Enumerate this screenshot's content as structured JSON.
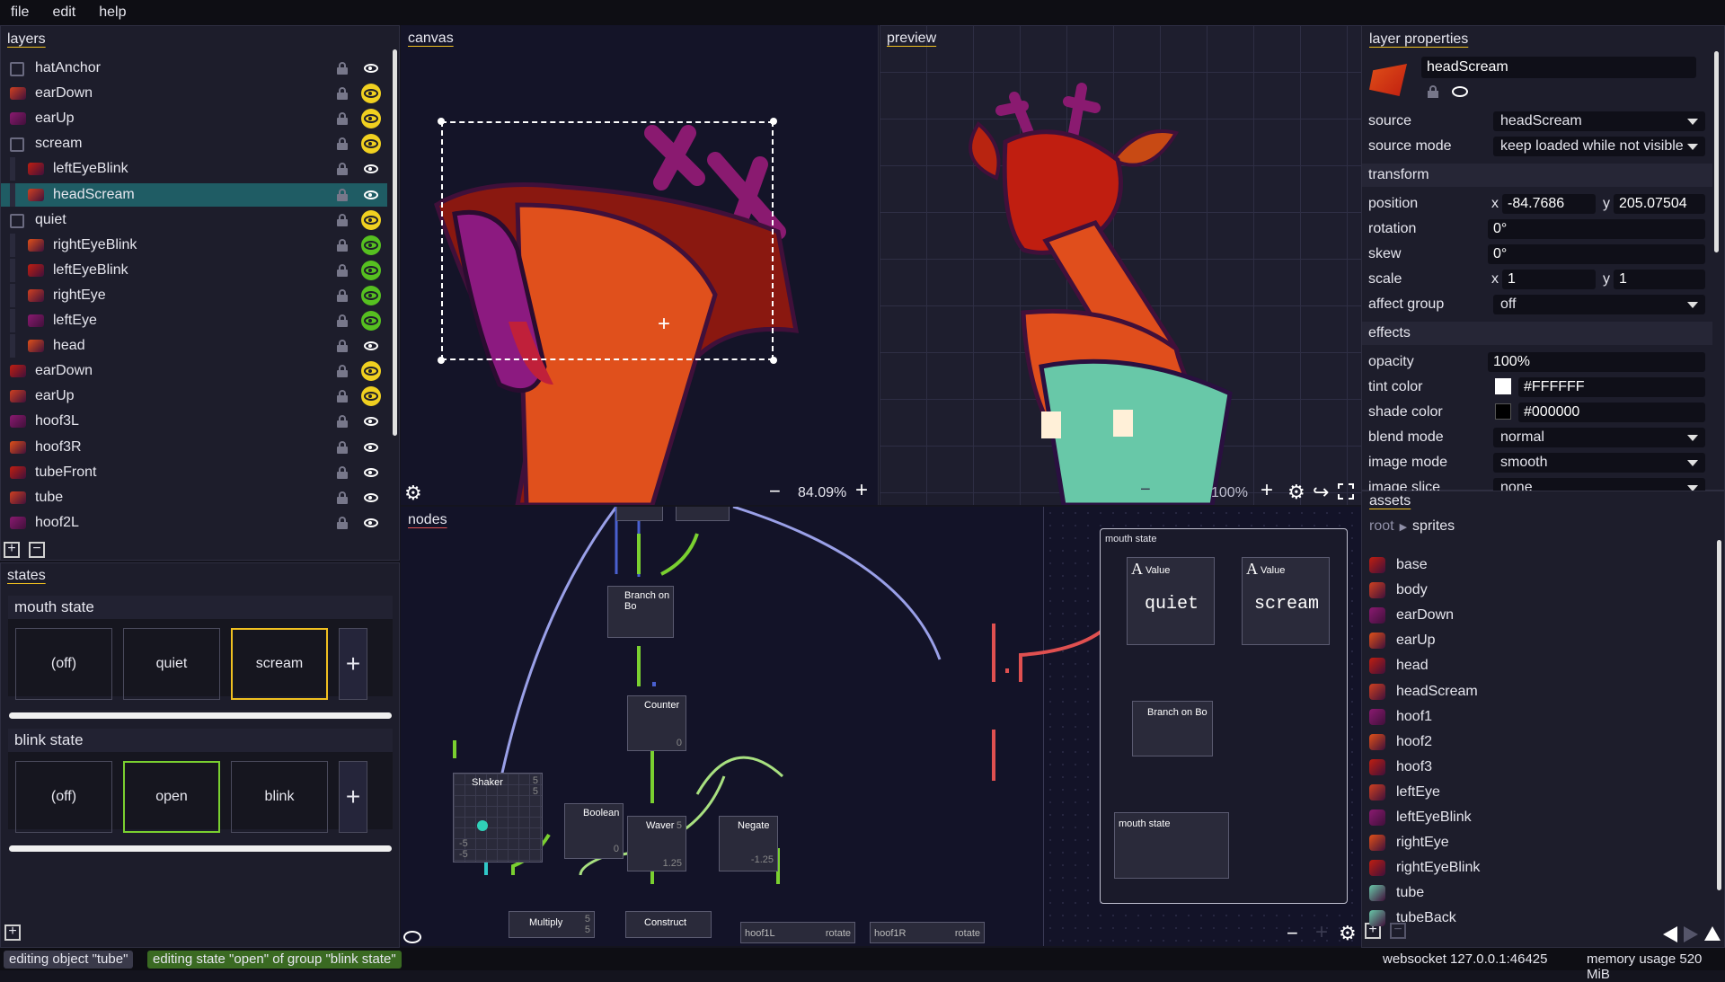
{
  "menu": {
    "file": "file",
    "edit": "edit",
    "help": "help"
  },
  "layers": {
    "title": "layers",
    "items": [
      {
        "name": "hatAnchor",
        "indent": 0,
        "icon": "checkbox",
        "eye": "plain"
      },
      {
        "name": "earDown",
        "indent": 0,
        "icon": "sprite",
        "eye": "yellow"
      },
      {
        "name": "earUp",
        "indent": 0,
        "icon": "sprite",
        "eye": "yellow"
      },
      {
        "name": "scream",
        "indent": 0,
        "icon": "checkbox",
        "eye": "yellow"
      },
      {
        "name": "leftEyeBlink",
        "indent": 1,
        "icon": "sprite",
        "eye": "plain"
      },
      {
        "name": "headScream",
        "indent": 1,
        "icon": "sprite",
        "eye": "plain",
        "selected": true
      },
      {
        "name": "quiet",
        "indent": 0,
        "icon": "checkbox",
        "eye": "yellow"
      },
      {
        "name": "rightEyeBlink",
        "indent": 1,
        "icon": "sprite",
        "eye": "green"
      },
      {
        "name": "leftEyeBlink",
        "indent": 1,
        "icon": "sprite",
        "eye": "green"
      },
      {
        "name": "rightEye",
        "indent": 1,
        "icon": "sprite",
        "eye": "green"
      },
      {
        "name": "leftEye",
        "indent": 1,
        "icon": "sprite",
        "eye": "green"
      },
      {
        "name": "head",
        "indent": 1,
        "icon": "sprite",
        "eye": "plain"
      },
      {
        "name": "earDown",
        "indent": 0,
        "icon": "sprite",
        "eye": "yellow"
      },
      {
        "name": "earUp",
        "indent": 0,
        "icon": "sprite",
        "eye": "yellow"
      },
      {
        "name": "hoof3L",
        "indent": 0,
        "icon": "sprite",
        "eye": "plain"
      },
      {
        "name": "hoof3R",
        "indent": 0,
        "icon": "sprite",
        "eye": "plain"
      },
      {
        "name": "tubeFront",
        "indent": 0,
        "icon": "sprite",
        "eye": "plain"
      },
      {
        "name": "tube",
        "indent": 0,
        "icon": "sprite",
        "eye": "plain"
      },
      {
        "name": "hoof2L",
        "indent": 0,
        "icon": "sprite",
        "eye": "plain"
      }
    ]
  },
  "states": {
    "title": "states",
    "groups": [
      {
        "name": "mouth state",
        "options": [
          "(off)",
          "quiet",
          "scream"
        ],
        "active": "scream"
      },
      {
        "name": "blink state",
        "options": [
          "(off)",
          "open",
          "blink"
        ],
        "active": "open"
      }
    ]
  },
  "canvas": {
    "title": "canvas",
    "zoom": "84.09%"
  },
  "preview": {
    "title": "preview",
    "zoom": "100%"
  },
  "nodes": {
    "title": "nodes",
    "labels": {
      "branch1": "Branch on Bo",
      "counter": "Counter",
      "counter_val": "0",
      "shaker": "Shaker",
      "shaker_val_top": "5",
      "shaker_val_top2": "5",
      "shaker_val_bot": "-5",
      "shaker_val_bot2": "-5",
      "boolean": "Boolean",
      "boolean_val": "0",
      "waver": "Waver",
      "waver_val": "5",
      "waver_val2": "1.25",
      "negate": "Negate",
      "negate_val": "-1.25",
      "multiply": "Multiply",
      "multiply_val": "5",
      "multiply_val2": "5",
      "construct": "Construct",
      "hoof1L": "hoof1L",
      "rotate1": "rotate",
      "hoof1R": "hoof1R",
      "rotate2": "rotate",
      "group_title": "mouth state",
      "value1_type": "Value",
      "value1": "quiet",
      "value2_type": "Value",
      "value2": "scream",
      "branch2": "Branch on Bo",
      "mouth_out": "mouth state"
    }
  },
  "properties": {
    "title": "layer properties",
    "layer_name": "headScream",
    "source_label": "source",
    "source": "headScream",
    "source_mode_label": "source mode",
    "source_mode": "keep loaded while not visible",
    "transform_header": "transform",
    "position_label": "position",
    "pos_x_label": "x",
    "pos_x": "-84.7686",
    "pos_y_label": "y",
    "pos_y": "205.07504",
    "rotation_label": "rotation",
    "rotation": "0°",
    "skew_label": "skew",
    "skew": "0°",
    "scale_label": "scale",
    "scale_x_label": "x",
    "scale_x": "1",
    "scale_y_label": "y",
    "scale_y": "1",
    "affect_group_label": "affect group",
    "affect_group": "off",
    "effects_header": "effects",
    "opacity_label": "opacity",
    "opacity": "100%",
    "tint_label": "tint color",
    "tint": "#FFFFFF",
    "shade_label": "shade color",
    "shade": "#000000",
    "blend_label": "blend mode",
    "blend": "normal",
    "image_mode_label": "image mode",
    "image_mode": "smooth",
    "image_slice_label": "image slice",
    "image_slice": "none"
  },
  "assets": {
    "title": "assets",
    "breadcrumb": [
      "root",
      "sprites"
    ],
    "items": [
      "base",
      "body",
      "earDown",
      "earUp",
      "head",
      "headScream",
      "hoof1",
      "hoof2",
      "hoof3",
      "leftEye",
      "leftEyeBlink",
      "rightEye",
      "rightEyeBlink",
      "tube",
      "tubeBack"
    ]
  },
  "status": {
    "object": "editing object \"tube\"",
    "state": "editing state \"open\" of group \"blink state\"",
    "websocket": "websocket 127.0.0.1:46425",
    "memory": "memory usage 520 MiB"
  },
  "colors": {
    "accent": "#f0c020",
    "selected": "#1f5c64",
    "green": "#7ad030",
    "yellow": "#f0d020",
    "red": "#e05050",
    "blue": "#4a60d0",
    "canvasbg": "#141428"
  }
}
